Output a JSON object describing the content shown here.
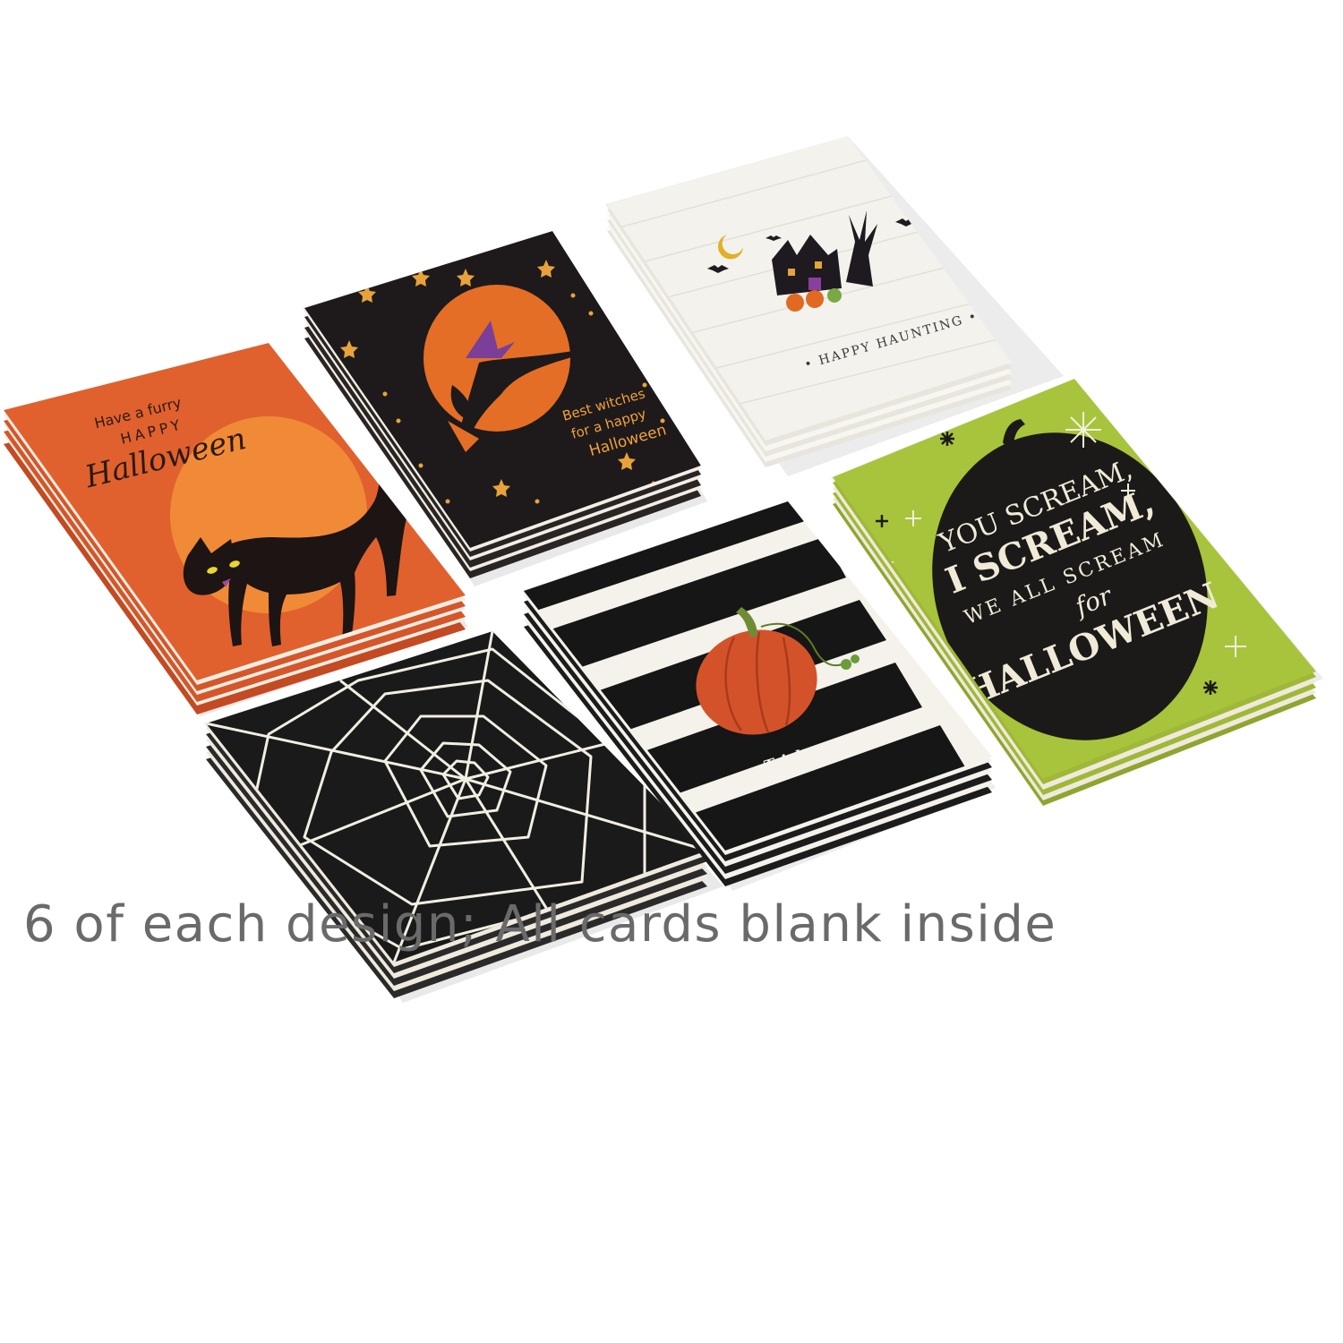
{
  "caption": "6 of each design; All cards blank inside",
  "cards": {
    "cat": {
      "line1": "Have a furry",
      "line2": "HAPPY",
      "line3": "Halloween",
      "bg": "#e0612e"
    },
    "witch": {
      "line1": "Best witches",
      "line2": "for a happy",
      "line3": "Halloween",
      "bg": "#1e1a1b",
      "accent": "#f2a13a"
    },
    "house": {
      "text": "• HAPPY HAUNTING •",
      "bg": "#f3f2ec"
    },
    "scream": {
      "line1": "YOU SCREAM,",
      "line2": "I SCREAM,",
      "line3": "WE ALL SCREAM",
      "line4": "for",
      "line5": "HALLOWEEN",
      "bg": "#a7c43c"
    },
    "web": {
      "bg": "#1a1a1a"
    },
    "stripes": {
      "text": "Trick or Treat",
      "bg": "#f4f2ea"
    }
  }
}
